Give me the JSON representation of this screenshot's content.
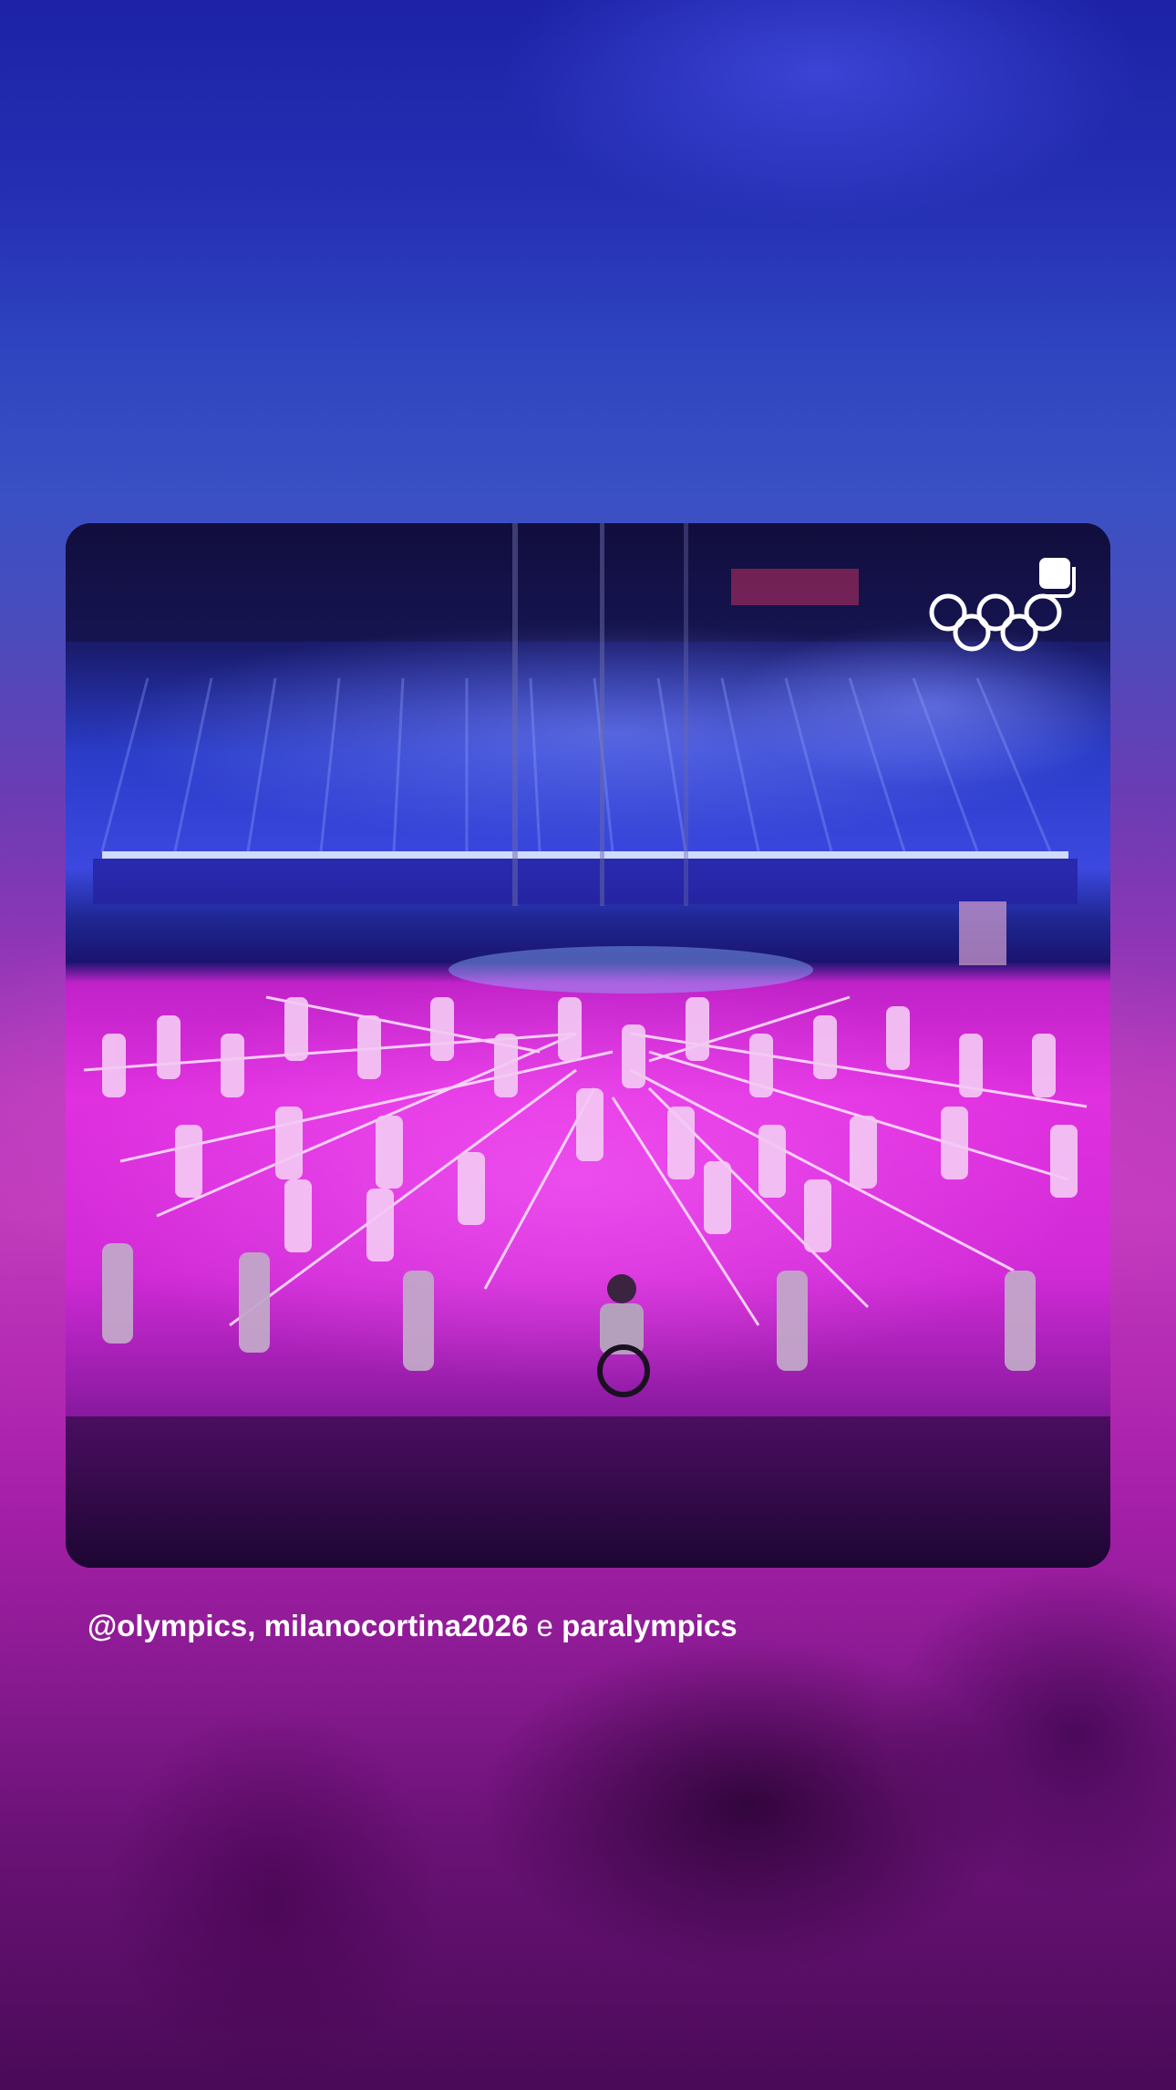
{
  "post": {
    "mention_handles": "@olympics, milanocortina2026",
    "conjunction": "e",
    "last_handle": "paralympics"
  },
  "media": {
    "image_description_label": "olympic-opening-ceremony-photo",
    "logo_icon": "olympic-rings-icon",
    "badge_icon": "multi-photo-badge-icon"
  },
  "colors": {
    "top_background": "#1d22a6",
    "mid_background": "#c03cbc",
    "bottom_background": "#4a0a58",
    "caption_text": "#ffffff"
  }
}
